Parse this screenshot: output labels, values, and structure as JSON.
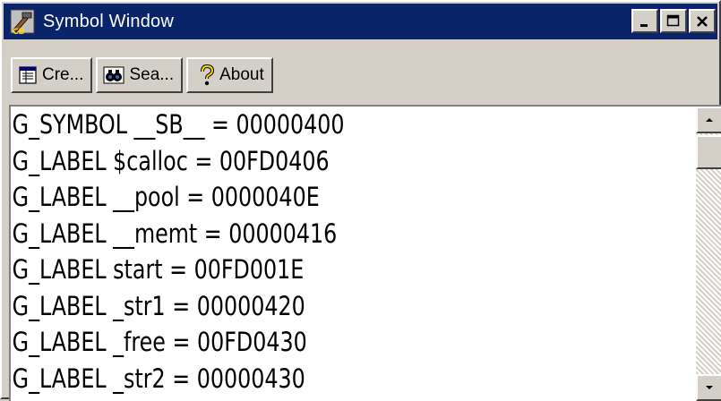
{
  "window": {
    "title": "Symbol Window",
    "controls": {
      "minimize": "minimize",
      "maximize": "maximize",
      "close": "close"
    }
  },
  "toolbar": {
    "create_label": "Cre...",
    "search_label": "Sea...",
    "about_label": "About"
  },
  "symbols": [
    "G_SYMBOL __SB__ = 00000400",
    "G_LABEL $calloc = 00FD0406",
    "G_LABEL __pool = 0000040E",
    "G_LABEL __memt = 00000416",
    "G_LABEL start = 00FD001E",
    "G_LABEL _str1 = 00000420",
    "G_LABEL _free = 00FD0430",
    "G_LABEL _str2 = 00000430"
  ],
  "colors": {
    "titlebar": "#0a246a",
    "face": "#d4d0c8",
    "list_bg": "#ffffff"
  },
  "icons": {
    "app": "cb-hammer-icon",
    "create": "document-list-icon",
    "search": "binoculars-icon",
    "about": "question-mark-icon"
  }
}
